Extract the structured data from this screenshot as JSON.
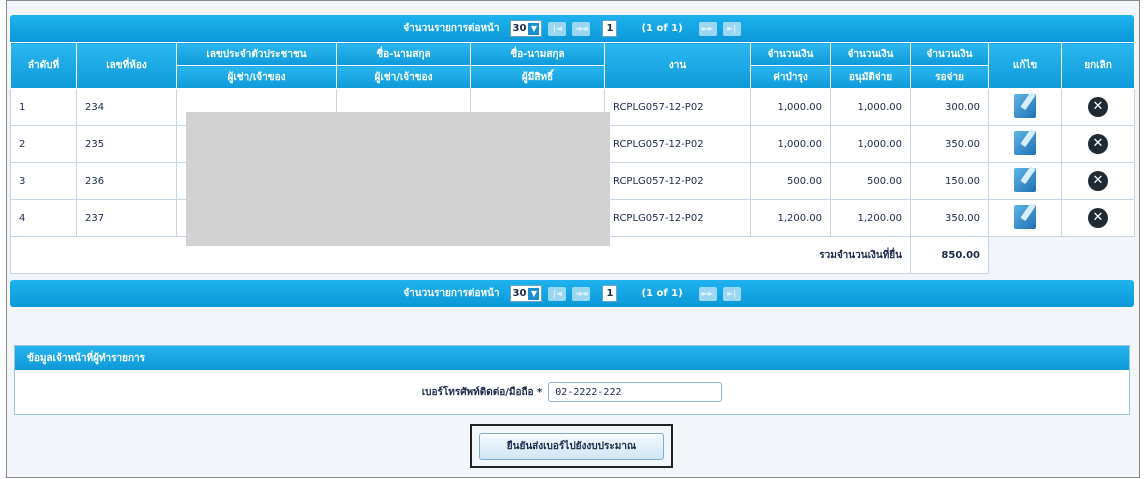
{
  "pager": {
    "rows_per_page_label": "จำนวนรายการต่อหน้า",
    "rows_per_page_value": "30",
    "first_symbol": "|◄",
    "prev_symbol": "◄◄",
    "current_page": "1",
    "page_info": "(1 of 1)",
    "next_symbol": "►►",
    "last_symbol": "►|"
  },
  "table": {
    "headers": {
      "index": "ลำดับที่",
      "room": "เลขที่ห้อง",
      "id_top": "เลขประจำตัวประชาชน",
      "id_bottom": "ผู้เช่า/เจ้าของ",
      "name_top": "ชื่อ-นามสกุล",
      "name_bottom": "ผู้เช่า/เจ้าของ",
      "name2_top": "ชื่อ-นามสกุล",
      "name2_bottom": "ผู้มีสิทธิ์",
      "code": "งาน",
      "amt1_top": "จำนวนเงิน",
      "amt1_bottom": "ค่าบำรุง",
      "amt2_top": "จำนวนเงิน",
      "amt2_bottom": "อนุมัติจ่าย",
      "amt3_top": "จำนวนเงิน",
      "amt3_bottom": "รอจ่าย",
      "edit": "แก้ไข",
      "delete": "ยกเลิก"
    },
    "rows": [
      {
        "index": "1",
        "room": "234",
        "code": "RCPLG057-12-P02",
        "amt1": "1,000.00",
        "amt2": "1,000.00",
        "amt3": "300.00"
      },
      {
        "index": "2",
        "room": "235",
        "code": "RCPLG057-12-P02",
        "amt1": "1,000.00",
        "amt2": "1,000.00",
        "amt3": "350.00"
      },
      {
        "index": "3",
        "room": "236",
        "code": "RCPLG057-12-P02",
        "amt1": "500.00",
        "amt2": "500.00",
        "amt3": "150.00"
      },
      {
        "index": "4",
        "room": "237",
        "code": "RCPLG057-12-P02",
        "amt1": "1,200.00",
        "amt2": "1,200.00",
        "amt3": "350.00"
      }
    ],
    "total_label": "รวมจำนวนเงินที่ยื่น",
    "total_value": "850.00"
  },
  "contact_panel": {
    "title": "ข้อมูลเจ้าหน้าที่ผู้ทำรายการ",
    "phone_label": "เบอร์โทรศัพท์ติดต่อ/มือถือ *",
    "phone_value": "02-2222-222"
  },
  "submit_button": "ยืนยันส่งเบอร์ไปยังงบประมาณ"
}
